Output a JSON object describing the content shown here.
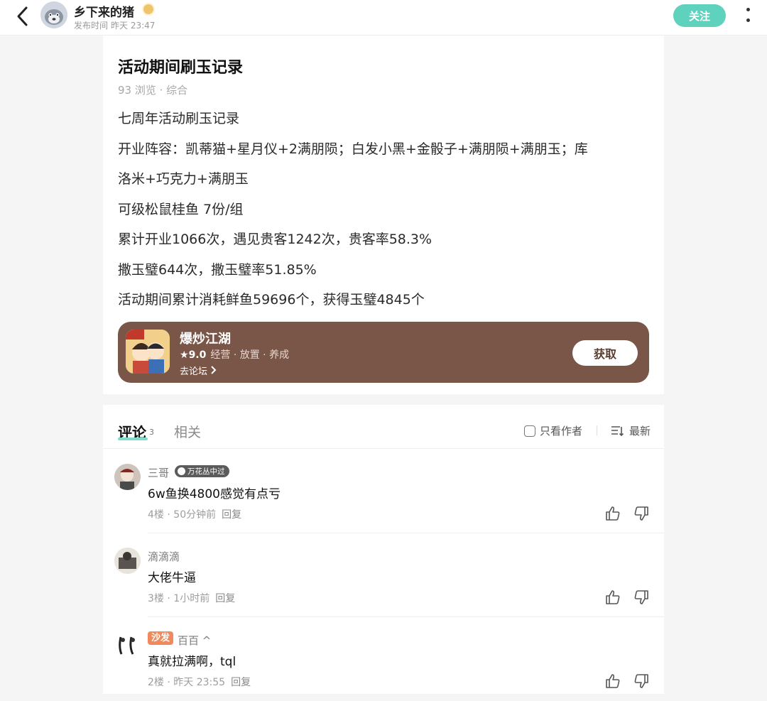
{
  "header": {
    "author_name": "乡下来的猪",
    "publish_label": "发布时间",
    "publish_time": "昨天 23:47",
    "follow_label": "关注"
  },
  "post": {
    "title": "活动期间刷玉记录",
    "views": "93 浏览",
    "category": "综合",
    "paragraphs": [
      "七周年活动刷玉记录",
      "开业阵容：凯蒂猫+星月仪+2满朋陨；白发小黑+金骰子+满朋陨+满朋玉；库",
      "洛米+巧克力+满朋玉",
      "可级松鼠桂鱼 7份/组",
      "累计开业1066次，遇见贵客1242次，贵客率58.3%",
      "撒玉璧644次，撒玉璧率51.85%",
      "活动期间累计消耗鲜鱼59696个，获得玉璧4845个"
    ]
  },
  "game_card": {
    "name": "爆炒江湖",
    "rating": "9.0",
    "tags": [
      "经营",
      "放置",
      "养成"
    ],
    "forum_link": "去论坛",
    "get_label": "获取",
    "colors": {
      "background": "#7a5648"
    }
  },
  "comments_section": {
    "tab_comments": "评论",
    "comment_count": "3",
    "tab_related": "相关",
    "only_author": "只看作者",
    "sort_label": "最新",
    "items": [
      {
        "name": "三哥",
        "badge": "万花丛中过",
        "text": "6w鱼换4800感觉有点亏",
        "floor": "4楼",
        "time": "50分钟前",
        "reply": "回复"
      },
      {
        "name": "滴滴滴",
        "text": "大佬牛逼",
        "floor": "3楼",
        "time": "1小时前",
        "reply": "回复"
      },
      {
        "sofa": "沙发",
        "name": "百百 ^",
        "text": "真就拉满啊，tql",
        "floor": "2楼",
        "time": "昨天 23:55",
        "reply": "回复"
      }
    ]
  },
  "colors": {
    "accent": "#5fd2bd",
    "sofa_badge": "#f08a5d"
  }
}
